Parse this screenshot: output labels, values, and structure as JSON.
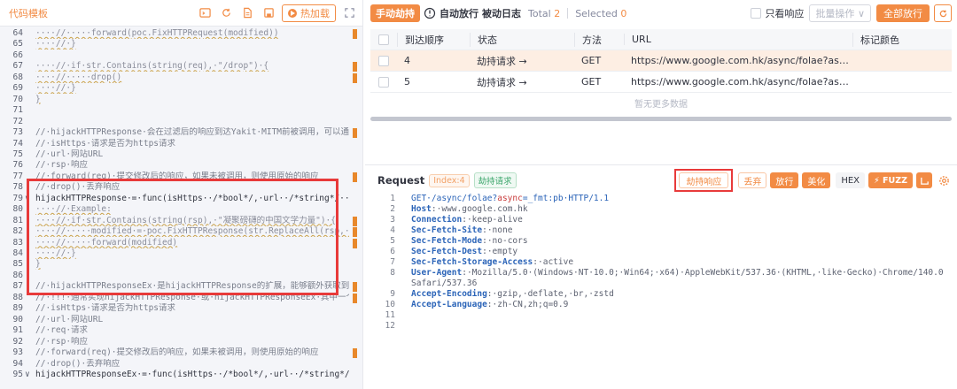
{
  "left": {
    "title": "代码模板",
    "hot_reload": "热加载",
    "lines": [
      {
        "n": "64",
        "t": "····//·····forward(poc.FixHTTPRequest(modified))",
        "s": "ul",
        "m": true
      },
      {
        "n": "65",
        "t": "····//·}",
        "s": "ul"
      },
      {
        "n": "66",
        "t": "",
        "s": "cm"
      },
      {
        "n": "67",
        "t": "····//·if·str.Contains(string(req),·\"/drop\")·{",
        "s": "ul",
        "m": true
      },
      {
        "n": "68",
        "t": "····//·····drop()",
        "s": "ul",
        "m": true
      },
      {
        "n": "69",
        "t": "····//·}",
        "s": "ul"
      },
      {
        "n": "70",
        "t": "}",
        "s": "ul"
      },
      {
        "n": "71",
        "t": "",
        "s": "cm"
      },
      {
        "n": "72",
        "t": "",
        "s": "cm"
      },
      {
        "n": "73",
        "t": "//·hijackHTTPResponse·会在过滤后的响应到达Yakit·MITM前被调用，可以通",
        "s": "cm",
        "m": true
      },
      {
        "n": "74",
        "t": "//·isHttps·请求是否为https请求",
        "s": "cm"
      },
      {
        "n": "75",
        "t": "//·url·网站URL",
        "s": "cm"
      },
      {
        "n": "76",
        "t": "//·rsp·响应",
        "s": "cm"
      },
      {
        "n": "77",
        "t": "//·forward(req)·提交修改后的响应，如果未被调用，则使用原始的响应",
        "s": "cm",
        "m": true
      },
      {
        "n": "78",
        "t": "//·drop()·丢弃响应",
        "s": "cm"
      },
      {
        "n": "79",
        "t": "hijackHTTPResponse·=·func(isHttps··/*bool*/,·url··/*string*/··r",
        "s": "fn",
        "fold": "∨"
      },
      {
        "n": "80",
        "t": "····//·Example:",
        "s": "ul"
      },
      {
        "n": "81",
        "t": "····//·if·str.Contains(string(rsp),·\"凝聚磅礴的中国文学力量\")·{",
        "s": "ul",
        "m": true
      },
      {
        "n": "82",
        "t": "····//·····modified·=·poc.FixHTTPResponse(str.ReplaceAll(rsp,·\"",
        "s": "ul",
        "m": true
      },
      {
        "n": "83",
        "t": "····//·····forward(modified)",
        "s": "ul",
        "m": true
      },
      {
        "n": "84",
        "t": "····//·}",
        "s": "ul"
      },
      {
        "n": "85",
        "t": "}",
        "s": "ul"
      },
      {
        "n": "86",
        "t": "",
        "s": "cm"
      },
      {
        "n": "87",
        "t": "//·hijackHTTPResponseEx·是hijackHTTPResponse的扩展，能够额外获取到响应",
        "s": "cm",
        "m": true
      },
      {
        "n": "88",
        "t": "//·!!!·通常实现hijackHTTPResponse·或·hijackHTTPResponseEx·其中一个",
        "s": "cm",
        "m": true
      },
      {
        "n": "89",
        "t": "//·isHttps·请求是否为https请求",
        "s": "cm"
      },
      {
        "n": "90",
        "t": "//·url·网站URL",
        "s": "cm"
      },
      {
        "n": "91",
        "t": "//·req·请求",
        "s": "cm"
      },
      {
        "n": "92",
        "t": "//·rsp·响应",
        "s": "cm"
      },
      {
        "n": "93",
        "t": "//·forward(req)·提交修改后的响应，如果未被调用，则使用原始的响应",
        "s": "cm",
        "m": true
      },
      {
        "n": "94",
        "t": "//·drop()·丢弃响应",
        "s": "cm"
      },
      {
        "n": "95",
        "t": "hijackHTTPResponseEx·=·func(isHttps··/*bool*/,·url··/*string*/·",
        "s": "fn",
        "fold": "∨"
      }
    ]
  },
  "toolbar": {
    "manual": "手动劫持",
    "auto": "自动放行",
    "passive": "被动日志",
    "total_label": "Total",
    "total_value": "2",
    "selected_label": "Selected",
    "selected_value": "0",
    "resp_only": "只看响应",
    "batch": "批量操作",
    "allow_all": "全部放行"
  },
  "table": {
    "headers": [
      "到达顺序",
      "状态",
      "方法",
      "URL",
      "标记颜色"
    ],
    "rows": [
      {
        "order": "4",
        "status": "劫持请求 →",
        "method": "GET",
        "url": "https://www.google.com.hk/async/folae?async=_f...",
        "color": ""
      },
      {
        "order": "5",
        "status": "劫持请求 →",
        "method": "GET",
        "url": "https://www.google.com.hk/async/folae?async=_f...",
        "color": ""
      }
    ],
    "no_more": "暂无更多数据"
  },
  "request": {
    "title": "Request",
    "index_tag": "Index:4",
    "hijack_tag": "劫持请求",
    "hijack_response": "劫持响应",
    "drop": "丢弃",
    "forward": "放行",
    "beautify": "美化",
    "hex": "HEX",
    "fuzz": "FUZZ",
    "lines": [
      {
        "n": "1",
        "k": "GET·/async/folae?",
        "q": "async",
        "v": "=_fmt:pb·HTTP/1.1",
        "type": "req"
      },
      {
        "n": "2",
        "k": "Host",
        "v": "·www.google.com.hk",
        "type": "hdr"
      },
      {
        "n": "3",
        "k": "Connection",
        "v": "·keep-alive",
        "type": "hdr"
      },
      {
        "n": "4",
        "k": "Sec-Fetch-Site",
        "v": "·none",
        "type": "hdr"
      },
      {
        "n": "5",
        "k": "Sec-Fetch-Mode",
        "v": "·no-cors",
        "type": "hdr"
      },
      {
        "n": "6",
        "k": "Sec-Fetch-Dest",
        "v": "·empty",
        "type": "hdr"
      },
      {
        "n": "7",
        "k": "Sec-Fetch-Storage-Access",
        "v": "·active",
        "type": "hdr"
      },
      {
        "n": "8",
        "k": "User-Agent",
        "v": "·Mozilla/5.0·(Windows·NT·10.0;·Win64;·x64)·AppleWebKit/537.36·(KHTML,·like·Gecko)·Chrome/140.0.0.0·",
        "type": "hdr"
      },
      {
        "n": "",
        "k": "",
        "v": "Safari/537.36",
        "type": "cont"
      },
      {
        "n": "9",
        "k": "Accept-Encoding",
        "v": "·gzip,·deflate,·br,·zstd",
        "type": "hdr"
      },
      {
        "n": "10",
        "k": "Accept-Language",
        "v": "·zh-CN,zh;q=0.9",
        "type": "hdr"
      },
      {
        "n": "11",
        "k": "",
        "v": "",
        "type": "cont"
      },
      {
        "n": "12",
        "k": "",
        "v": "",
        "type": "cont"
      }
    ]
  }
}
